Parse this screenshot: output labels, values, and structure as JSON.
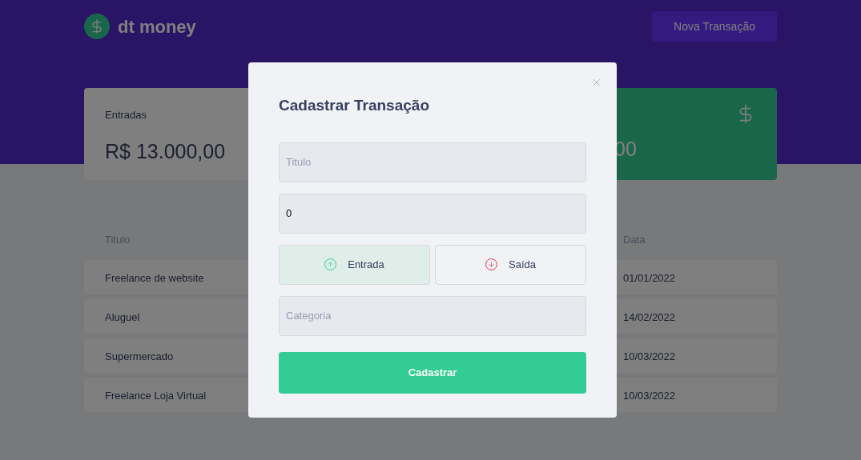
{
  "header": {
    "logo_text": "dt money",
    "new_button": "Nova Transação"
  },
  "summary_cards": [
    {
      "kind": "income",
      "label": "Entradas",
      "value": "R$ 13.000,00"
    },
    {
      "kind": "total",
      "value": "00"
    }
  ],
  "table": {
    "columns": [
      "Titulo",
      "Data"
    ],
    "rows": [
      {
        "cells": [
          "Freelance de website",
          "01/01/2022"
        ]
      },
      {
        "cells": [
          "Aluguel",
          "14/02/2022"
        ]
      },
      {
        "cells": [
          "Supermercado",
          "10/03/2022"
        ]
      },
      {
        "cells": [
          "Freelance Loja Virtual",
          "10/03/2022"
        ]
      }
    ]
  },
  "modal": {
    "title": "Cadastrar Transação",
    "fields": [
      {
        "placeholder": "Titulo"
      },
      {
        "value": "0"
      }
    ],
    "type_options": [
      {
        "kind": "deposit",
        "label": "Entrada",
        "selected": true
      },
      {
        "kind": "withdraw",
        "label": "Saída",
        "selected": false
      }
    ],
    "category": {
      "placeholder": "Categoria"
    },
    "submit": "Cadastrar"
  }
}
